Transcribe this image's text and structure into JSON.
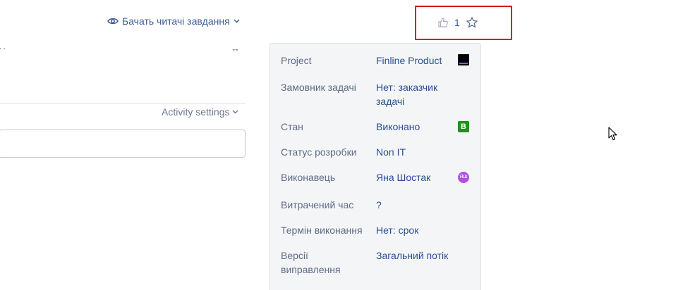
{
  "header": {
    "watch_label": "Бачать читачі завдання",
    "vote_count": "1"
  },
  "activity": {
    "settings_label": "Activity settings"
  },
  "details": {
    "fields": [
      {
        "label": "Project",
        "value": "Finline Product",
        "icon": "project-icon"
      },
      {
        "label": "Замовник задачі",
        "value": "Нет: заказчик задачі"
      },
      {
        "label": "Стан",
        "value": "Виконано",
        "badge": "В",
        "badge_color": "#21901f"
      },
      {
        "label": "Статус розробки",
        "value": "Non IT"
      },
      {
        "label": "Виконавець",
        "value": "Яна Шостак",
        "avatar": "ЯШ",
        "avatar_color": "#b04fe2"
      },
      {
        "label": "Витрачений час",
        "value": "?"
      },
      {
        "label": "Термін виконання",
        "value": "Нет: срок"
      },
      {
        "label": "Версії виправлення",
        "value": "Загальний потік"
      }
    ]
  },
  "colors": {
    "link": "#2a4e92",
    "highlight_border": "#e00000",
    "panel_bg": "#f4f5f7"
  }
}
